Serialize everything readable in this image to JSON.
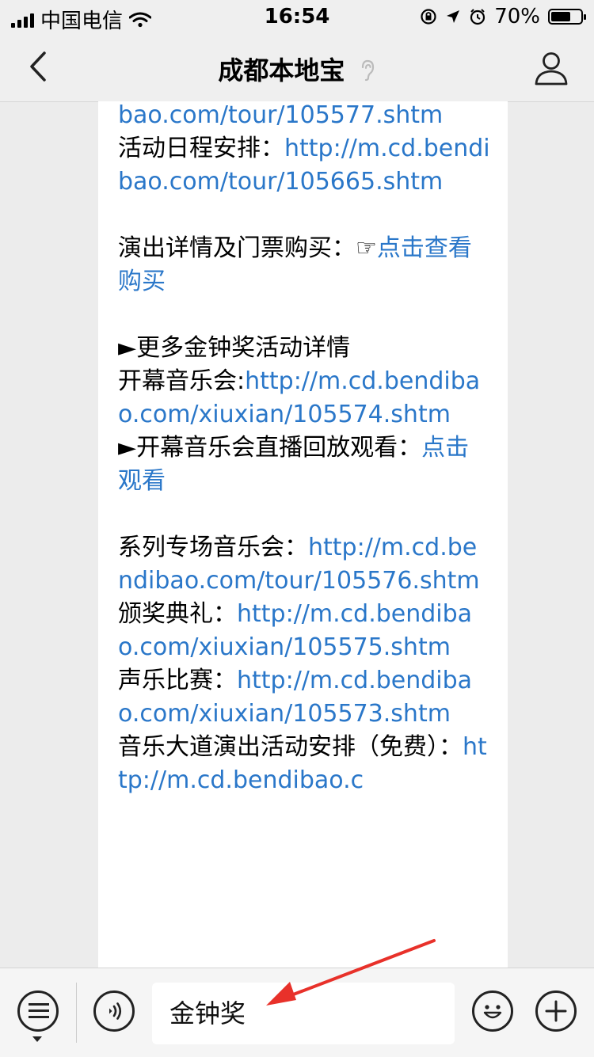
{
  "status_bar": {
    "carrier": "中国电信",
    "time": "16:54",
    "battery_percent_label": "70%",
    "battery_level": 0.7
  },
  "nav": {
    "title": "成都本地宝"
  },
  "article": {
    "lines": [
      {
        "text": "",
        "link": "bao.com/tour/105577.shtm"
      },
      {
        "text": "活动日程安排：",
        "link": "http://m.cd.bendibao.com/tour/105665.shtm"
      },
      {
        "blank": true
      },
      {
        "text": "演出详情及门票购买：☞",
        "link": "点击查看购买"
      },
      {
        "blank": true
      },
      {
        "text": "►更多金钟奖活动详情",
        "link": ""
      },
      {
        "text": "开幕音乐会:",
        "link": "http://m.cd.bendibao.com/xiuxian/105574.shtm"
      },
      {
        "text": "►开幕音乐会直播回放观看：",
        "link": "点击观看"
      },
      {
        "blank": true
      },
      {
        "text": "系列专场音乐会：",
        "link": "http://m.cd.bendibao.com/tour/105576.shtm"
      },
      {
        "text": "颁奖典礼：",
        "link": "http://m.cd.bendibao.com/xiuxian/105575.shtm"
      },
      {
        "text": "声乐比赛：",
        "link": "http://m.cd.bendibao.com/xiuxian/105573.shtm"
      },
      {
        "text": "音乐大道演出活动安排（免费）：",
        "link": "http://m.cd.bendibao.c"
      }
    ]
  },
  "input_bar": {
    "input_value": "金钟奖"
  },
  "colors": {
    "link": "#2a77c9",
    "arrow": "#e8312a"
  },
  "icons": {
    "back": "back-chevron-icon",
    "ear": "ear-icon",
    "profile": "person-icon",
    "menu": "menu-list-icon",
    "voice": "voice-icon",
    "emoji": "emoji-icon",
    "plus": "plus-icon"
  }
}
